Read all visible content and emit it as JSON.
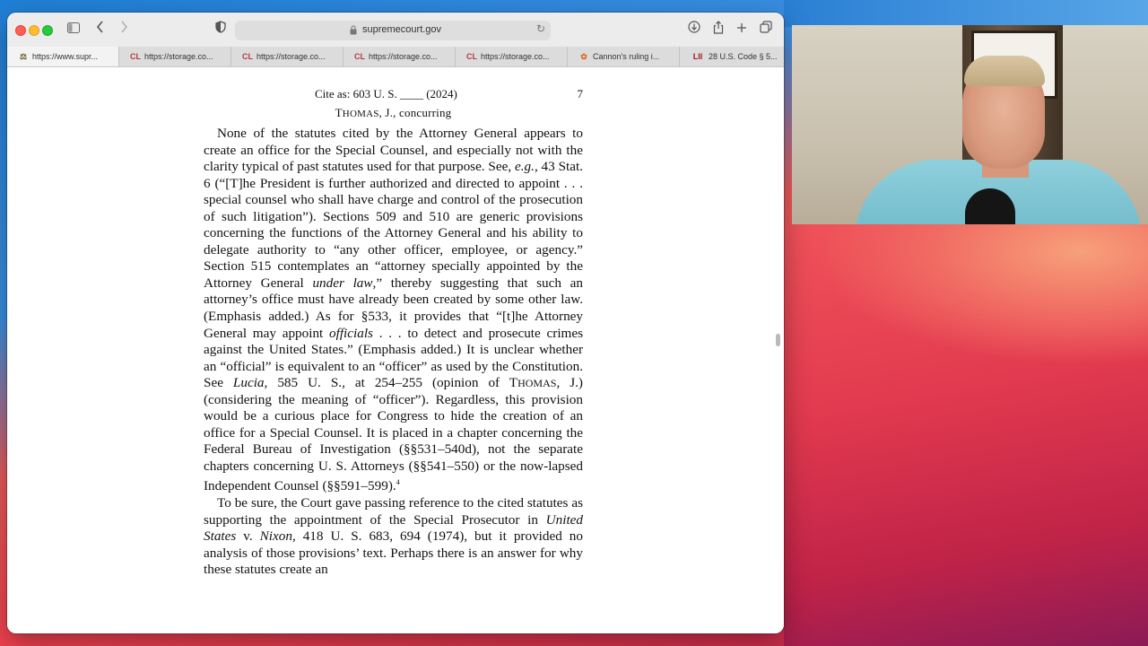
{
  "browser": {
    "address_url": "supremecourt.gov",
    "tabs": [
      {
        "favicon": "court-seal-icon",
        "fav_text": "⚖",
        "label": "https://www.supr..."
      },
      {
        "favicon": "courtlistener-icon",
        "fav_text": "CL",
        "label": "https://storage.co..."
      },
      {
        "favicon": "courtlistener-icon",
        "fav_text": "CL",
        "label": "https://storage.co..."
      },
      {
        "favicon": "courtlistener-icon",
        "fav_text": "CL",
        "label": "https://storage.co..."
      },
      {
        "favicon": "courtlistener-icon",
        "fav_text": "CL",
        "label": "https://storage.co..."
      },
      {
        "favicon": "nbc-peacock-icon",
        "fav_text": "✿",
        "label": "Cannon's ruling i..."
      },
      {
        "favicon": "lii-icon",
        "fav_text": "LII",
        "label": "28 U.S. Code § 5..."
      }
    ]
  },
  "document": {
    "cite": "Cite as:  603 U. S. ____ (2024)",
    "page_number": "7",
    "opinion_head_prefix": "T",
    "opinion_head_smallcaps": "HOMAS",
    "opinion_head_rest": ", J., concurring",
    "para1": {
      "t1": "None of the statutes cited by the Attorney General appears to create an office for the Special Counsel, and especially not with the clarity typical of past statutes used for that purpose.  See, ",
      "i1": "e.g.",
      "t2": ", 43 Stat. 6 (“[T]he President is further authorized and directed to appoint . . . special counsel who shall have charge and control of the prosecution of such litigation”).  Sections 509 and 510 are generic provisions concerning the functions of the Attorney General and his ability to delegate authority to “any other officer, employee, or agency.”  Section 515 contemplates an “attorney specially appointed by the Attorney General ",
      "i2": "under law",
      "t3": ",” thereby suggesting that such an attorney’s office must have already been created by some other law.  (Emphasis added.)  As for §533, it provides that “[t]he Attorney General may appoint ",
      "i3": "officials",
      "t4": " . . . to detect and prosecute crimes against the United States.”  (Emphasis added.)  It is unclear whether an “official” is equivalent to an “officer” as used by the Constitution.  See ",
      "i4": "Lucia",
      "t5": ", 585 U. S., at 254–255 (opinion of T",
      "sc1": "HOMAS",
      "t6": ", J.) (considering the meaning of “officer”).  Regardless, this provision would be a curious place for Congress to hide the creation of an office for a Special Counsel.  It is placed in a chapter concerning the Federal Bureau of Investigation (§§531–540d), not the separate chapters concerning U. S. Attorneys (§§541–550) or the now-lapsed Independent Counsel (§§591–599).",
      "footnote": "4"
    },
    "para2": {
      "t1": "To be sure, the Court gave passing reference to the cited statutes as supporting the appointment of the Special Prosecutor in ",
      "i1": "United States",
      "t2": " v. ",
      "i2": "Nixon",
      "t3": ", 418 U. S. 683, 694 (1974), but it provided no analysis of those provisions’ text.  Perhaps there is an answer for why these statutes create an"
    }
  }
}
